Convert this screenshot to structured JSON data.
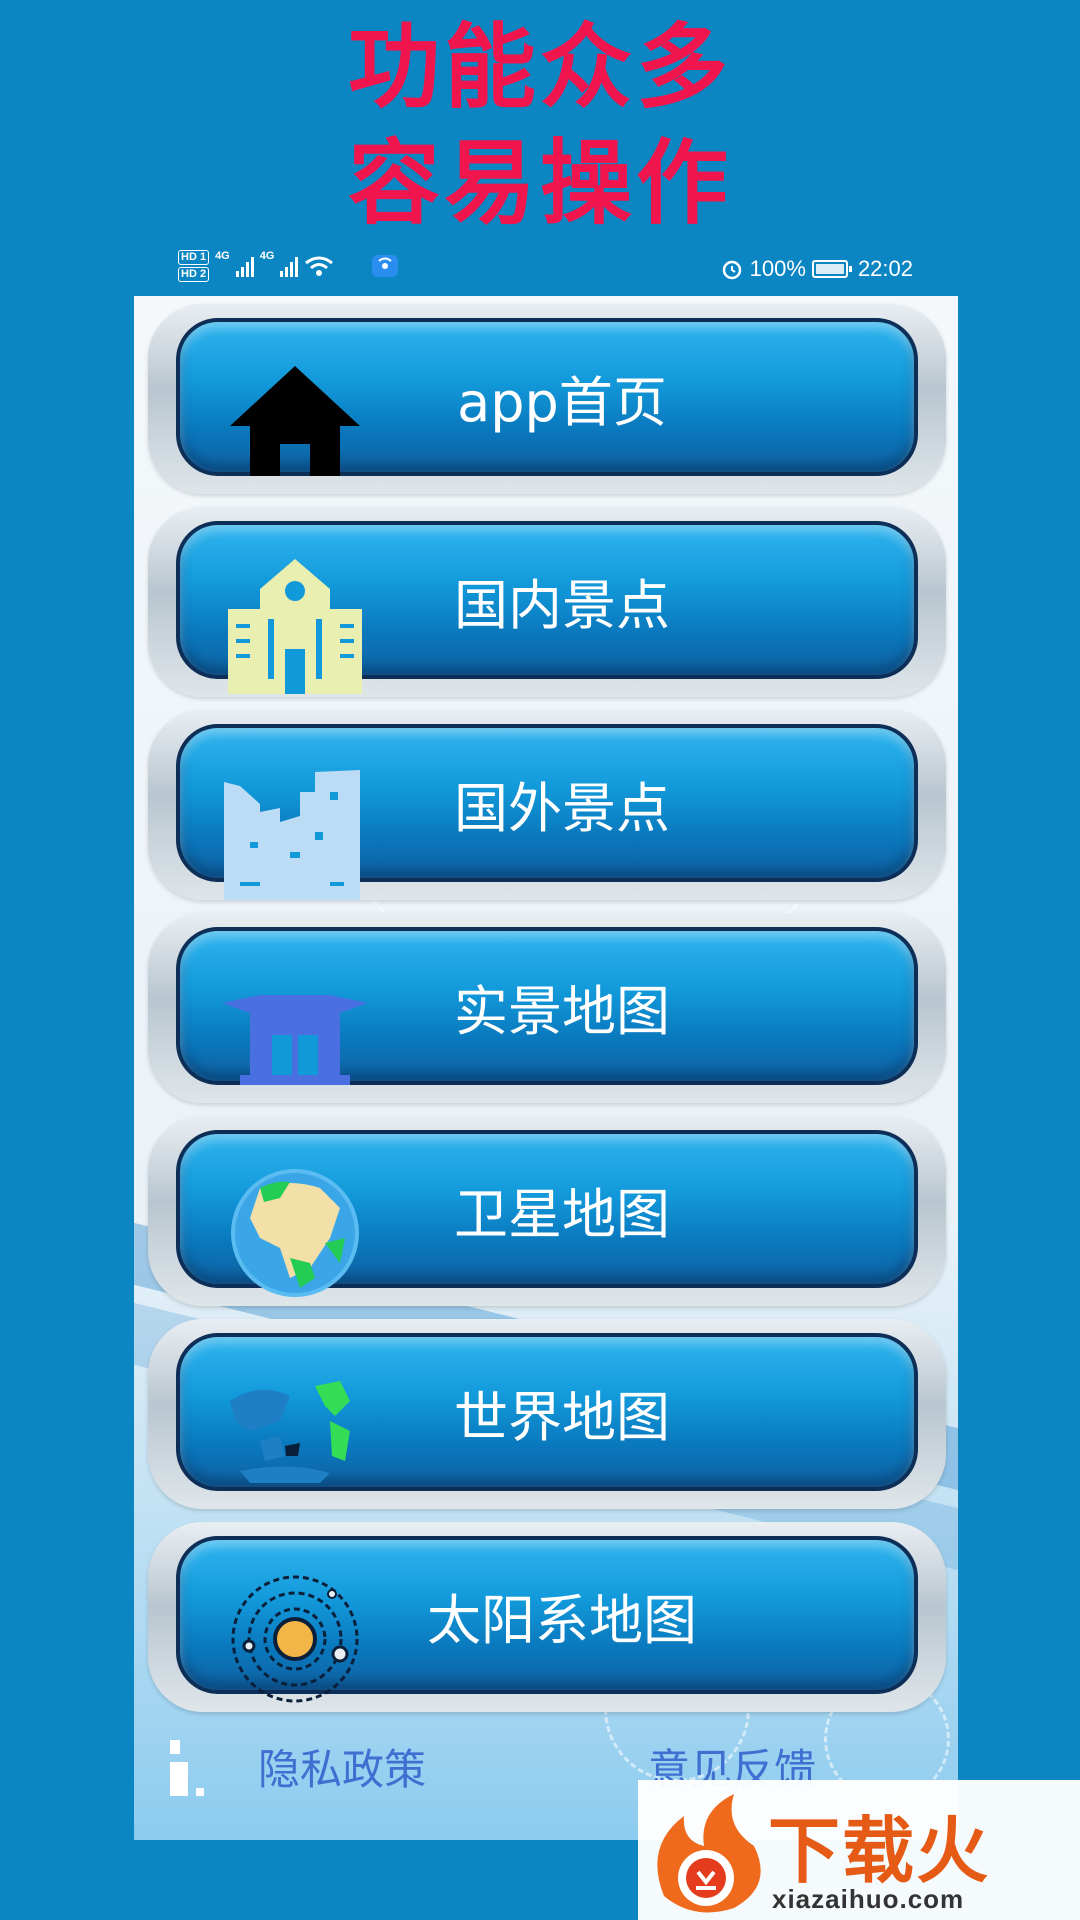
{
  "promo": {
    "line1": "功能众多",
    "line2": "容易操作"
  },
  "status_bar": {
    "hd1": "HD 1",
    "hd2": "HD 2",
    "net1": "4G",
    "net2": "4G",
    "battery_percent": "100%",
    "time": "22:02"
  },
  "menu": {
    "items": [
      {
        "label": "app首页",
        "icon": "home-icon"
      },
      {
        "label": "国内景点",
        "icon": "building-icon"
      },
      {
        "label": "国外景点",
        "icon": "city-icon"
      },
      {
        "label": "实景地图",
        "icon": "temple-icon"
      },
      {
        "label": "卫星地图",
        "icon": "globe-icon"
      },
      {
        "label": "世界地图",
        "icon": "world-map-icon"
      },
      {
        "label": "太阳系地图",
        "icon": "solar-system-icon"
      }
    ]
  },
  "footer": {
    "privacy": "隐私政策",
    "feedback": "意见反馈"
  },
  "watermark": {
    "brand": "下载火",
    "domain": "xiazaihuo.com"
  },
  "colors": {
    "background": "#0b86c3",
    "headline": "#f0154d",
    "button_blue": "#1299da",
    "footer_link": "#3f6fd1"
  }
}
